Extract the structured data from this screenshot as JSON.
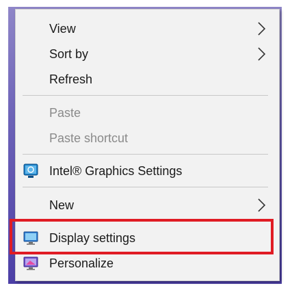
{
  "menu": {
    "view": "View",
    "sort_by": "Sort by",
    "refresh": "Refresh",
    "paste": "Paste",
    "paste_shortcut": "Paste shortcut",
    "intel_graphics": "Intel® Graphics Settings",
    "new": "New",
    "display_settings": "Display settings",
    "personalize": "Personalize"
  },
  "icons": {
    "submenu": "chevron-right-icon",
    "intel": "intel-graphics-icon",
    "display": "display-monitor-icon",
    "personalize": "personalize-monitor-icon"
  },
  "colors": {
    "highlight": "#e01c24",
    "menu_bg": "#f2f2f2",
    "disabled_text": "#8a8a8a"
  }
}
